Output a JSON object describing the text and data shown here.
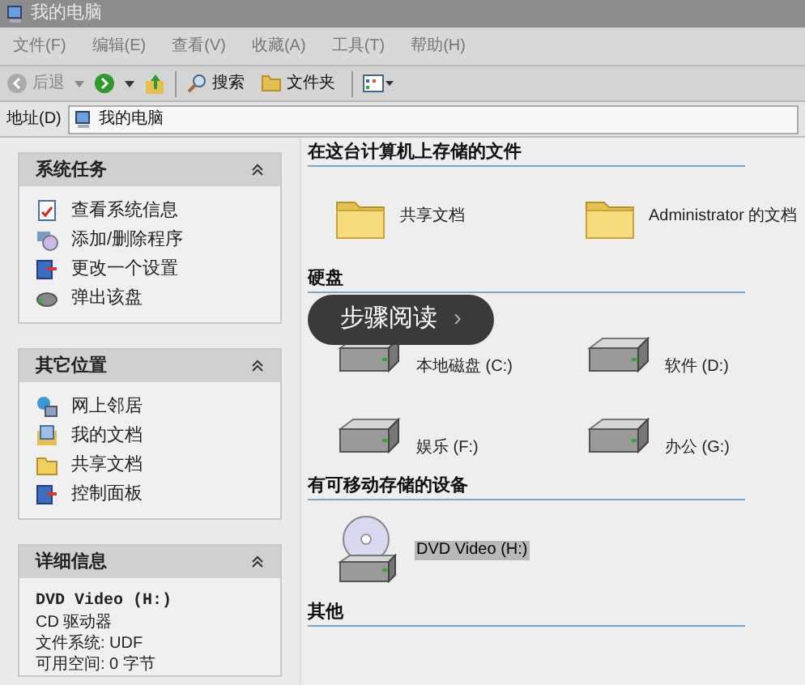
{
  "window": {
    "title": "我的电脑"
  },
  "menu": [
    {
      "label": "文件(F)"
    },
    {
      "label": "编辑(E)"
    },
    {
      "label": "查看(V)"
    },
    {
      "label": "收藏(A)"
    },
    {
      "label": "工具(T)"
    },
    {
      "label": "帮助(H)"
    }
  ],
  "toolbar": {
    "back": "后退",
    "search": "搜索",
    "folders": "文件夹"
  },
  "address": {
    "label": "地址(D)",
    "value": "我的电脑"
  },
  "sidebar": {
    "panels": [
      {
        "title": "系统任务",
        "expanded": true,
        "kind": "links",
        "items": [
          {
            "label": "查看系统信息",
            "kind": "info"
          },
          {
            "label": "添加/删除程序",
            "kind": "cd"
          },
          {
            "label": "更改一个设置",
            "kind": "panel"
          },
          {
            "label": "弹出该盘",
            "kind": "drive"
          }
        ]
      },
      {
        "title": "其它位置",
        "expanded": true,
        "kind": "links",
        "items": [
          {
            "label": "网上邻居",
            "kind": "network"
          },
          {
            "label": "我的文档",
            "kind": "docs"
          },
          {
            "label": "共享文档",
            "kind": "folder"
          },
          {
            "label": "控制面板",
            "kind": "panel"
          }
        ]
      },
      {
        "title": "详细信息",
        "expanded": true,
        "kind": "details",
        "name": "DVD Video (H:)",
        "lines": [
          "CD 驱动器",
          "文件系统: UDF",
          "可用空间: 0 字节"
        ]
      }
    ]
  },
  "sections": [
    {
      "title": "在这台计算机上存储的文件",
      "items": [
        {
          "label": "共享文档",
          "kind": "folder",
          "selected": false
        },
        {
          "label": "Administrator 的文档",
          "kind": "folder",
          "selected": false
        }
      ]
    },
    {
      "title": "硬盘",
      "items": [
        {
          "label": "本地磁盘 (C:)",
          "kind": "drive",
          "selected": false
        },
        {
          "label": "软件 (D:)",
          "kind": "drive",
          "selected": false
        },
        {
          "label": "娱乐 (F:)",
          "kind": "drive",
          "selected": false
        },
        {
          "label": "办公 (G:)",
          "kind": "drive",
          "selected": false
        }
      ]
    },
    {
      "title": "有可移动存储的设备",
      "items": [
        {
          "label": "DVD Video (H:)",
          "kind": "cd",
          "selected": true
        }
      ]
    },
    {
      "title": "其他"
    }
  ],
  "overlay": {
    "label": "步骤阅读",
    "arrow": "›"
  }
}
